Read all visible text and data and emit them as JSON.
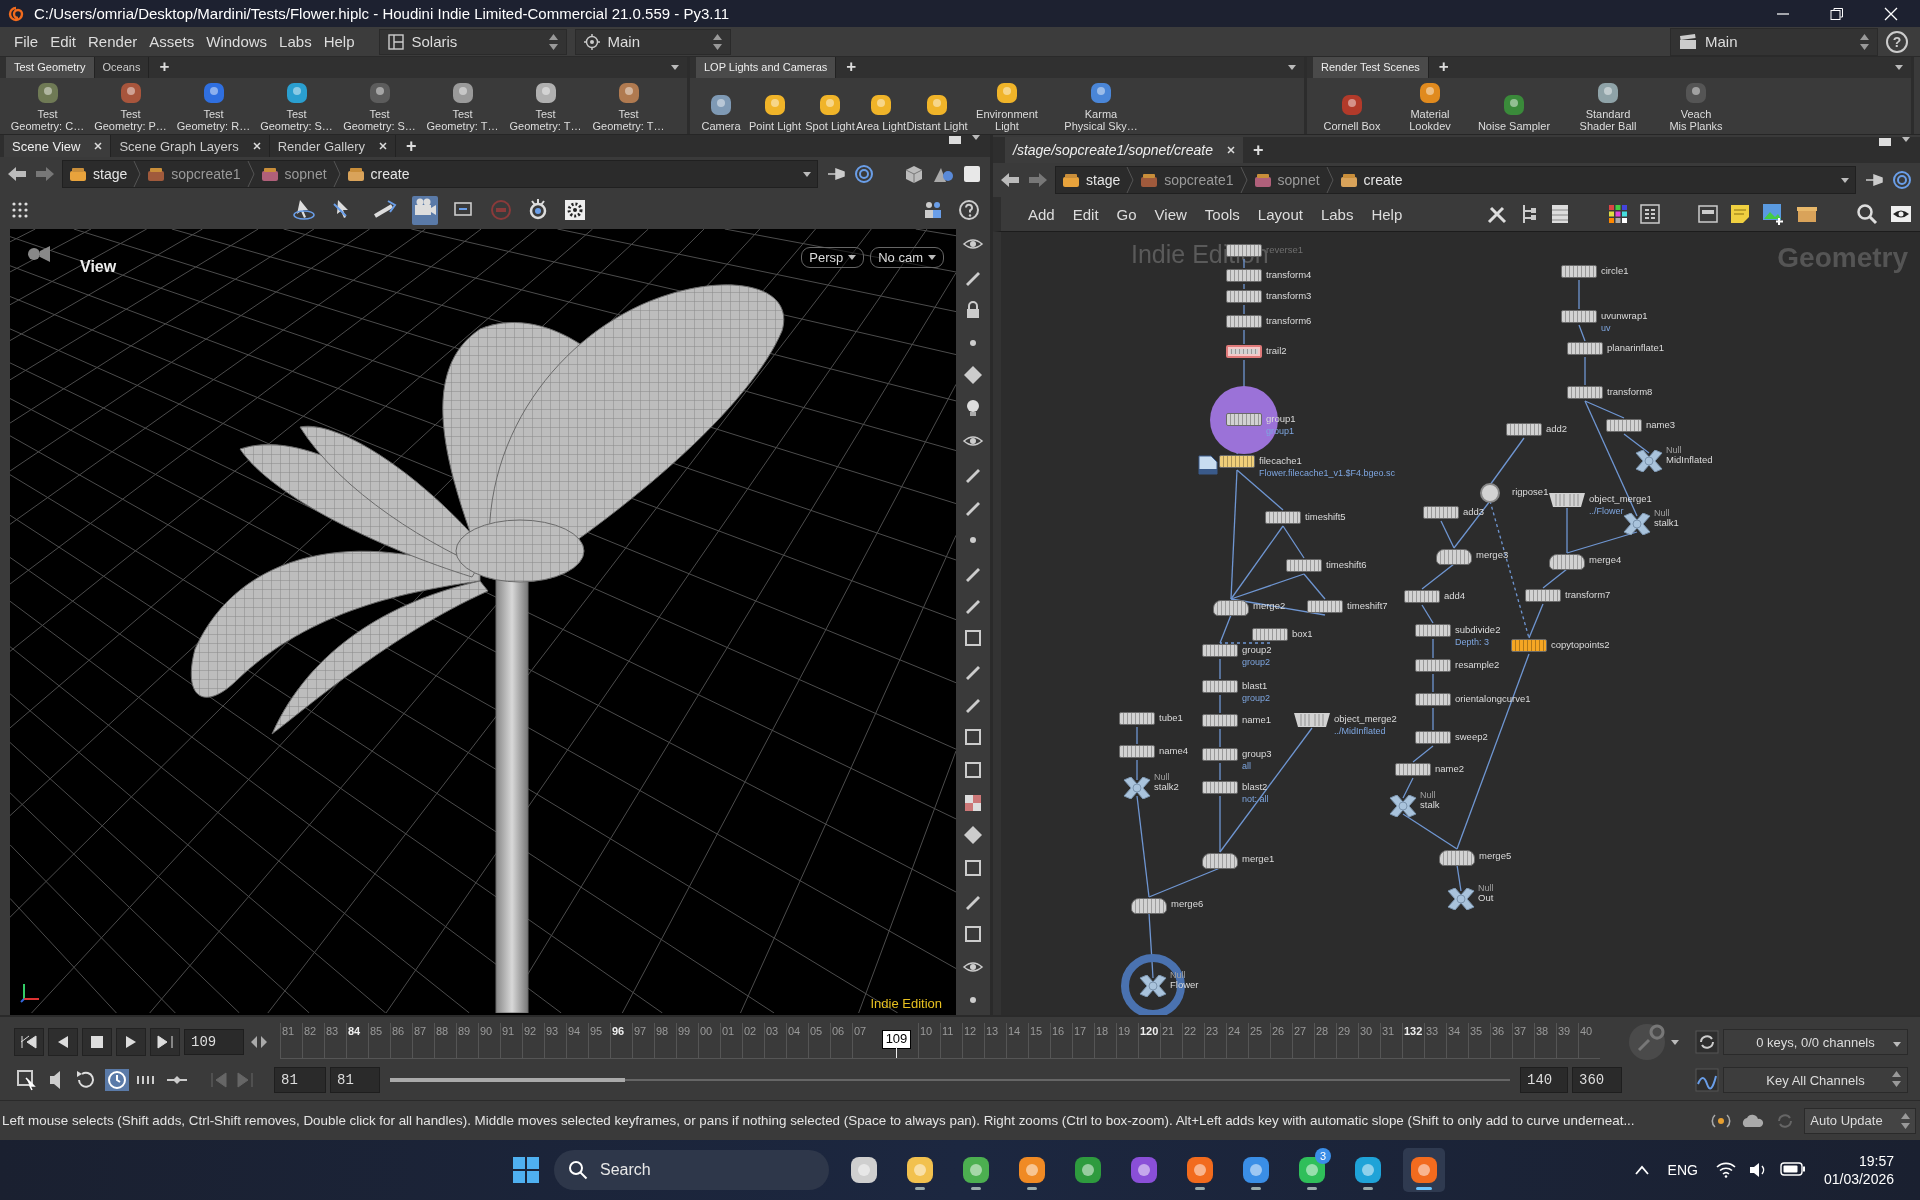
{
  "window": {
    "title": "C:/Users/omria/Desktop/Mardini/Tests/Flower.hiplc - Houdini Indie Limited-Commercial 21.0.559 - Py3.11"
  },
  "menu": {
    "items": [
      "File",
      "Edit",
      "Render",
      "Assets",
      "Windows",
      "Labs",
      "Help"
    ],
    "desktop": "Solaris",
    "context": "Main",
    "take": "Main",
    "help": "?"
  },
  "shelves": [
    {
      "tabs": [
        {
          "label": "Test Geometry",
          "selected": true
        },
        {
          "label": "Oceans",
          "selected": false
        }
      ],
      "add_tab": "+",
      "tools": [
        {
          "label": "Test\nGeometry: C…",
          "color": "#6f7a55"
        },
        {
          "label": "Test\nGeometry: P…",
          "color": "#a8553c"
        },
        {
          "label": "Test\nGeometry: R…",
          "color": "#2f6fe0"
        },
        {
          "label": "Test\nGeometry: S…",
          "color": "#2a9fd0"
        },
        {
          "label": "Test\nGeometry: S…",
          "color": "#5c5c5c"
        },
        {
          "label": "Test\nGeometry: T…",
          "color": "#9a9a9a"
        },
        {
          "label": "Test\nGeometry: T…",
          "color": "#b0b0b0"
        },
        {
          "label": "Test\nGeometry: T…",
          "color": "#b07a50"
        }
      ]
    },
    {
      "tabs": [
        {
          "label": "LOP Lights and Cameras",
          "selected": true
        }
      ],
      "add_tab": "+",
      "tools": [
        {
          "label": "Camera",
          "color": "#7f9ab5"
        },
        {
          "label": "Point Light",
          "color": "#f0b429"
        },
        {
          "label": "Spot Light",
          "color": "#f0b429"
        },
        {
          "label": "Area Light",
          "color": "#f0b429"
        },
        {
          "label": "Distant Light",
          "color": "#f0b429"
        },
        {
          "label": "Environment\nLight",
          "color": "#f0b429"
        },
        {
          "label": "Karma\nPhysical Sky…",
          "color": "#4a86d8"
        }
      ]
    },
    {
      "tabs": [
        {
          "label": "Render Test Scenes",
          "selected": true
        }
      ],
      "add_tab": "+",
      "tools": [
        {
          "label": "Cornell Box",
          "color": "#b23a2a"
        },
        {
          "label": "Material\nLookdev",
          "color": "#e08a1e"
        },
        {
          "label": "Noise Sampler",
          "color": "#3a8a3a"
        },
        {
          "label": "Standard\nShader Ball",
          "color": "#8fa3a8"
        },
        {
          "label": "Veach\nMis Planks",
          "color": "#555555"
        }
      ]
    }
  ],
  "viewer": {
    "tabs": [
      {
        "label": "Scene View",
        "selected": true
      },
      {
        "label": "Scene Graph Layers",
        "selected": false
      },
      {
        "label": "Render Gallery",
        "selected": false
      }
    ],
    "add_tab": "+",
    "path": [
      "stage",
      "sopcreate1",
      "sopnet",
      "create"
    ],
    "view_label": "View",
    "camera_menus": [
      "Persp",
      "No cam"
    ],
    "edition": "Indie Edition"
  },
  "network": {
    "tabs": [
      {
        "label": "/stage/sopcreate1/sopnet/create",
        "selected": true
      }
    ],
    "add_tab": "+",
    "path": [
      "stage",
      "sopcreate1",
      "sopnet",
      "create"
    ],
    "menu": [
      "Add",
      "Edit",
      "Go",
      "View",
      "Tools",
      "Layout",
      "Labs",
      "Help"
    ],
    "edition": "Indie Edition",
    "context": "Geometry",
    "nodes": [
      {
        "name": "reverse1",
        "kind": "op",
        "color": "#d2d2d2",
        "dimmed": true,
        "selected": false,
        "circled": false,
        "ringed": false
      },
      {
        "name": "transform4",
        "kind": "op",
        "color": "#d2d2d2",
        "dimmed": false,
        "selected": false,
        "circled": false,
        "ringed": false
      },
      {
        "name": "transform3",
        "kind": "op",
        "color": "#d2d2d2",
        "dimmed": false,
        "selected": false,
        "circled": false,
        "ringed": false
      },
      {
        "name": "transform6",
        "kind": "op",
        "color": "#d2d2d2",
        "dimmed": false,
        "selected": false,
        "circled": false,
        "ringed": false
      },
      {
        "name": "trail2",
        "kind": "op",
        "color": "#d2d2d2",
        "dimmed": false,
        "selected": true,
        "circled": false,
        "ringed": false
      },
      {
        "name": "group1",
        "kind": "op",
        "color": "#d2d2d2",
        "dimmed": false,
        "selected": false,
        "circled": true,
        "ringed": false,
        "sub": "group1"
      },
      {
        "name": "filecache1",
        "kind": "cache",
        "color": "#f0cf7a",
        "dimmed": false,
        "selected": false,
        "circled": false,
        "ringed": false,
        "sub": "Flower.filecache1_v1.$F4.bgeo.sc"
      },
      {
        "name": "timeshift5",
        "kind": "op",
        "color": "#d2d2d2",
        "dimmed": false,
        "selected": false,
        "circled": false,
        "ringed": false
      },
      {
        "name": "timeshift6",
        "kind": "op",
        "color": "#d2d2d2",
        "dimmed": false,
        "selected": false,
        "circled": false,
        "ringed": false
      },
      {
        "name": "merge2",
        "kind": "merge",
        "color": "#d2d2d2",
        "dimmed": false,
        "selected": false,
        "circled": false,
        "ringed": false
      },
      {
        "name": "timeshift7",
        "kind": "op",
        "color": "#d2d2d2",
        "dimmed": false,
        "selected": false,
        "circled": false,
        "ringed": false
      },
      {
        "name": "box1",
        "kind": "op",
        "color": "#d2d2d2",
        "dimmed": false,
        "selected": false,
        "circled": false,
        "ringed": false
      },
      {
        "name": "group2",
        "kind": "op",
        "color": "#d2d2d2",
        "dimmed": false,
        "selected": false,
        "circled": false,
        "ringed": false,
        "sub": "group2"
      },
      {
        "name": "blast1",
        "kind": "op",
        "color": "#d2d2d2",
        "dimmed": false,
        "selected": false,
        "circled": false,
        "ringed": false,
        "sub": "group2"
      },
      {
        "name": "name1",
        "kind": "op",
        "color": "#d2d2d2",
        "dimmed": false,
        "selected": false,
        "circled": false,
        "ringed": false
      },
      {
        "name": "group3",
        "kind": "op",
        "color": "#d2d2d2",
        "dimmed": false,
        "selected": false,
        "circled": false,
        "ringed": false,
        "sub": "all"
      },
      {
        "name": "blast2",
        "kind": "op",
        "color": "#d2d2d2",
        "dimmed": false,
        "selected": false,
        "circled": false,
        "ringed": false,
        "sub": "not: all"
      },
      {
        "name": "object_merge2",
        "kind": "fetch",
        "color": "#d2d2d2",
        "dimmed": false,
        "selected": false,
        "circled": false,
        "ringed": false,
        "sub": "../MidInflated"
      },
      {
        "name": "merge1",
        "kind": "merge",
        "color": "#d2d2d2",
        "dimmed": false,
        "selected": false,
        "circled": false,
        "ringed": false
      },
      {
        "name": "tube1",
        "kind": "op",
        "color": "#d2d2d2",
        "dimmed": false,
        "selected": false,
        "circled": false,
        "ringed": false
      },
      {
        "name": "name4",
        "kind": "op",
        "color": "#d2d2d2",
        "dimmed": false,
        "selected": false,
        "circled": false,
        "ringed": false
      },
      {
        "name": "stalk2",
        "kind": "null",
        "type_label": "Null",
        "color": "#a9c3dc",
        "dimmed": false,
        "selected": false,
        "circled": false,
        "ringed": false
      },
      {
        "name": "merge6",
        "kind": "merge",
        "color": "#d2d2d2",
        "dimmed": false,
        "selected": false,
        "circled": false,
        "ringed": false
      },
      {
        "name": "Flower",
        "kind": "null",
        "type_label": "Null",
        "color": "#a9c3dc",
        "dimmed": false,
        "selected": false,
        "circled": false,
        "ringed": true
      },
      {
        "name": "circle1",
        "kind": "op",
        "color": "#d2d2d2",
        "dimmed": false,
        "selected": false,
        "circled": false,
        "ringed": false
      },
      {
        "name": "uvunwrap1",
        "kind": "op",
        "color": "#d2d2d2",
        "dimmed": false,
        "selected": false,
        "circled": false,
        "ringed": false,
        "sub": "uv"
      },
      {
        "name": "planarinflate1",
        "kind": "op",
        "color": "#d2d2d2",
        "dimmed": false,
        "selected": false,
        "circled": false,
        "ringed": false
      },
      {
        "name": "transform8",
        "kind": "op",
        "color": "#d2d2d2",
        "dimmed": false,
        "selected": false,
        "circled": false,
        "ringed": false
      },
      {
        "name": "name3",
        "kind": "op",
        "color": "#d2d2d2",
        "dimmed": false,
        "selected": false,
        "circled": false,
        "ringed": false
      },
      {
        "name": "MidInflated",
        "kind": "null",
        "type_label": "Null",
        "color": "#a9c3dc",
        "dimmed": false,
        "selected": false,
        "circled": false,
        "ringed": false
      },
      {
        "name": "add2",
        "kind": "op",
        "color": "#d2d2d2",
        "dimmed": false,
        "selected": false,
        "circled": false,
        "ringed": false
      },
      {
        "name": "rigpose1",
        "kind": "rig",
        "color": "#d2d2d2",
        "dimmed": false,
        "selected": false,
        "circled": false,
        "ringed": false
      },
      {
        "name": "add3",
        "kind": "op",
        "color": "#d2d2d2",
        "dimmed": false,
        "selected": false,
        "circled": false,
        "ringed": false
      },
      {
        "name": "object_merge1",
        "kind": "fetch",
        "color": "#d2d2d2",
        "dimmed": false,
        "selected": false,
        "circled": false,
        "ringed": false,
        "sub": "../Flower"
      },
      {
        "name": "stalk1",
        "kind": "null",
        "type_label": "Null",
        "color": "#a9c3dc",
        "dimmed": false,
        "selected": false,
        "circled": false,
        "ringed": false
      },
      {
        "name": "merge3",
        "kind": "merge",
        "color": "#d2d2d2",
        "dimmed": false,
        "selected": false,
        "circled": false,
        "ringed": false
      },
      {
        "name": "merge4",
        "kind": "merge",
        "color": "#d2d2d2",
        "dimmed": false,
        "selected": false,
        "circled": false,
        "ringed": false
      },
      {
        "name": "add4",
        "kind": "op",
        "color": "#d2d2d2",
        "dimmed": false,
        "selected": false,
        "circled": false,
        "ringed": false
      },
      {
        "name": "transform7",
        "kind": "op",
        "color": "#d2d2d2",
        "dimmed": false,
        "selected": false,
        "circled": false,
        "ringed": false
      },
      {
        "name": "subdivide2",
        "kind": "op",
        "color": "#d2d2d2",
        "dimmed": false,
        "selected": false,
        "circled": false,
        "ringed": false,
        "sub": "Depth: 3"
      },
      {
        "name": "copytopoints2",
        "kind": "op",
        "color": "#f5a623",
        "dimmed": false,
        "selected": false,
        "circled": false,
        "ringed": false
      },
      {
        "name": "resample2",
        "kind": "op",
        "color": "#d2d2d2",
        "dimmed": false,
        "selected": false,
        "circled": false,
        "ringed": false
      },
      {
        "name": "orientalongcurve1",
        "kind": "op",
        "color": "#d2d2d2",
        "dimmed": false,
        "selected": false,
        "circled": false,
        "ringed": false
      },
      {
        "name": "sweep2",
        "kind": "op",
        "color": "#d2d2d2",
        "dimmed": false,
        "selected": false,
        "circled": false,
        "ringed": false
      },
      {
        "name": "name2",
        "kind": "op",
        "color": "#d2d2d2",
        "dimmed": false,
        "selected": false,
        "circled": false,
        "ringed": false
      },
      {
        "name": "stalk",
        "kind": "null",
        "type_label": "Null",
        "color": "#a9c3dc",
        "dimmed": false,
        "selected": false,
        "circled": false,
        "ringed": false
      },
      {
        "name": "merge5",
        "kind": "merge",
        "color": "#d2d2d2",
        "dimmed": false,
        "selected": false,
        "circled": false,
        "ringed": false
      },
      {
        "name": "Out",
        "kind": "null",
        "type_label": "Null",
        "color": "#a9c3dc",
        "dimmed": false,
        "selected": false,
        "circled": false,
        "ringed": false
      }
    ]
  },
  "timeline": {
    "frame": "109",
    "ticks": [
      {
        "label": "81",
        "kind": "minor"
      },
      {
        "label": "82",
        "kind": "minor"
      },
      {
        "label": "83",
        "kind": "minor"
      },
      {
        "label": "84",
        "kind": "major"
      },
      {
        "label": "85",
        "kind": "minor"
      },
      {
        "label": "86",
        "kind": "minor"
      },
      {
        "label": "87",
        "kind": "minor"
      },
      {
        "label": "88",
        "kind": "minor"
      },
      {
        "label": "89",
        "kind": "minor"
      },
      {
        "label": "90",
        "kind": "minor"
      },
      {
        "label": "91",
        "kind": "minor"
      },
      {
        "label": "92",
        "kind": "minor"
      },
      {
        "label": "93",
        "kind": "minor"
      },
      {
        "label": "94",
        "kind": "minor"
      },
      {
        "label": "95",
        "kind": "minor"
      },
      {
        "label": "96",
        "kind": "major"
      },
      {
        "label": "97",
        "kind": "minor"
      },
      {
        "label": "98",
        "kind": "minor"
      },
      {
        "label": "99",
        "kind": "minor"
      },
      {
        "label": "00",
        "kind": "minor"
      },
      {
        "label": "01",
        "kind": "minor"
      },
      {
        "label": "02",
        "kind": "minor"
      },
      {
        "label": "03",
        "kind": "minor"
      },
      {
        "label": "04",
        "kind": "minor"
      },
      {
        "label": "05",
        "kind": "minor"
      },
      {
        "label": "06",
        "kind": "minor"
      },
      {
        "label": "07",
        "kind": "minor"
      },
      {
        "label": "109",
        "kind": "marker"
      },
      {
        "label": "10",
        "kind": "minor"
      },
      {
        "label": "11",
        "kind": "minor"
      },
      {
        "label": "12",
        "kind": "minor"
      },
      {
        "label": "13",
        "kind": "minor"
      },
      {
        "label": "14",
        "kind": "minor"
      },
      {
        "label": "15",
        "kind": "minor"
      },
      {
        "label": "16",
        "kind": "minor"
      },
      {
        "label": "17",
        "kind": "minor"
      },
      {
        "label": "18",
        "kind": "minor"
      },
      {
        "label": "19",
        "kind": "minor"
      },
      {
        "label": "120",
        "kind": "major"
      },
      {
        "label": "21",
        "kind": "minor"
      },
      {
        "label": "22",
        "kind": "minor"
      },
      {
        "label": "23",
        "kind": "minor"
      },
      {
        "label": "24",
        "kind": "minor"
      },
      {
        "label": "25",
        "kind": "minor"
      },
      {
        "label": "26",
        "kind": "minor"
      },
      {
        "label": "27",
        "kind": "minor"
      },
      {
        "label": "28",
        "kind": "minor"
      },
      {
        "label": "29",
        "kind": "minor"
      },
      {
        "label": "30",
        "kind": "minor"
      },
      {
        "label": "31",
        "kind": "minor"
      },
      {
        "label": "132",
        "kind": "major"
      },
      {
        "label": "33",
        "kind": "minor"
      },
      {
        "label": "34",
        "kind": "minor"
      },
      {
        "label": "35",
        "kind": "minor"
      },
      {
        "label": "36",
        "kind": "minor"
      },
      {
        "label": "37",
        "kind": "minor"
      },
      {
        "label": "38",
        "kind": "minor"
      },
      {
        "label": "39",
        "kind": "minor"
      },
      {
        "label": "40",
        "kind": "minor"
      }
    ],
    "start": "81",
    "range_start": "81",
    "range_end": "140",
    "end": "360",
    "range_slider": {
      "level": 0.21
    },
    "keys": "0 keys, 0/0 channels",
    "key_mode": "Key All Channels"
  },
  "status": {
    "message": "Left mouse selects (Shift adds, Ctrl-Shift removes, Double click for all handles). Middle moves selected keyframes, or pans if nothing selected (Space to always pan). Right zooms (Ctrl to box-zoom). Alt+Left adds key with automatic slope (Shift to only add to curve underneat...",
    "update": "Auto Update"
  },
  "taskbar": {
    "search": "Search",
    "apps": [
      {
        "color": "#cfcfcf",
        "running": false,
        "selected": false
      },
      {
        "color": "#f2c14e",
        "running": true,
        "selected": false
      },
      {
        "color": "#4caf50",
        "running": true,
        "selected": false
      },
      {
        "color": "#f08a24",
        "running": true,
        "selected": false
      },
      {
        "color": "#2e9b3e",
        "running": false,
        "selected": false
      },
      {
        "color": "#8a4fd8",
        "running": false,
        "selected": false
      },
      {
        "color": "#f26b1d",
        "running": true,
        "selected": false
      },
      {
        "color": "#3a8ee6",
        "running": true,
        "selected": false
      },
      {
        "color": "#2fbf5a",
        "running": true,
        "selected": false,
        "badge": "3"
      },
      {
        "color": "#1fa3d8",
        "running": true,
        "selected": false
      },
      {
        "color": "#f26b1e",
        "running": true,
        "selected": true
      }
    ],
    "language": "ENG",
    "time": "19:57",
    "date": "01/03/2026"
  }
}
